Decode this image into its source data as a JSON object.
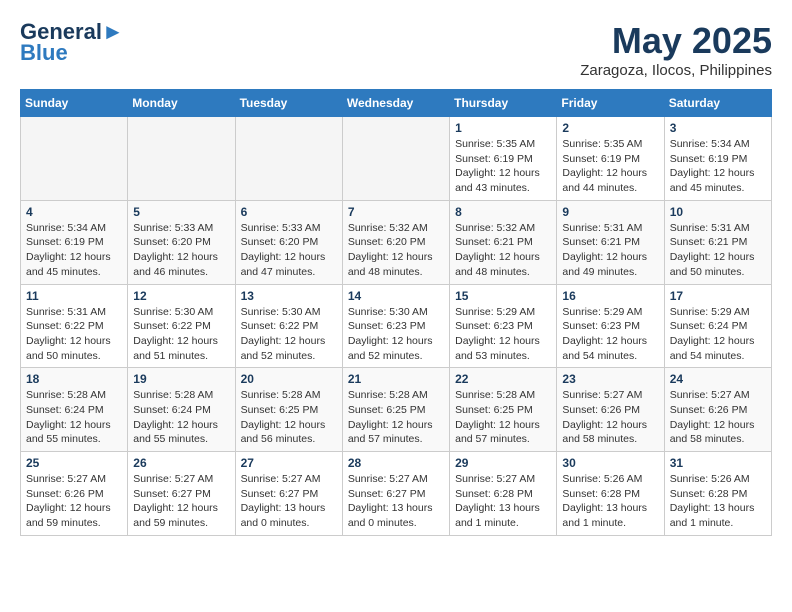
{
  "header": {
    "logo_line1": "General",
    "logo_line2": "Blue",
    "month": "May 2025",
    "location": "Zaragoza, Ilocos, Philippines"
  },
  "weekdays": [
    "Sunday",
    "Monday",
    "Tuesday",
    "Wednesday",
    "Thursday",
    "Friday",
    "Saturday"
  ],
  "weeks": [
    [
      {
        "day": "",
        "info": ""
      },
      {
        "day": "",
        "info": ""
      },
      {
        "day": "",
        "info": ""
      },
      {
        "day": "",
        "info": ""
      },
      {
        "day": "1",
        "info": "Sunrise: 5:35 AM\nSunset: 6:19 PM\nDaylight: 12 hours\nand 43 minutes."
      },
      {
        "day": "2",
        "info": "Sunrise: 5:35 AM\nSunset: 6:19 PM\nDaylight: 12 hours\nand 44 minutes."
      },
      {
        "day": "3",
        "info": "Sunrise: 5:34 AM\nSunset: 6:19 PM\nDaylight: 12 hours\nand 45 minutes."
      }
    ],
    [
      {
        "day": "4",
        "info": "Sunrise: 5:34 AM\nSunset: 6:19 PM\nDaylight: 12 hours\nand 45 minutes."
      },
      {
        "day": "5",
        "info": "Sunrise: 5:33 AM\nSunset: 6:20 PM\nDaylight: 12 hours\nand 46 minutes."
      },
      {
        "day": "6",
        "info": "Sunrise: 5:33 AM\nSunset: 6:20 PM\nDaylight: 12 hours\nand 47 minutes."
      },
      {
        "day": "7",
        "info": "Sunrise: 5:32 AM\nSunset: 6:20 PM\nDaylight: 12 hours\nand 48 minutes."
      },
      {
        "day": "8",
        "info": "Sunrise: 5:32 AM\nSunset: 6:21 PM\nDaylight: 12 hours\nand 48 minutes."
      },
      {
        "day": "9",
        "info": "Sunrise: 5:31 AM\nSunset: 6:21 PM\nDaylight: 12 hours\nand 49 minutes."
      },
      {
        "day": "10",
        "info": "Sunrise: 5:31 AM\nSunset: 6:21 PM\nDaylight: 12 hours\nand 50 minutes."
      }
    ],
    [
      {
        "day": "11",
        "info": "Sunrise: 5:31 AM\nSunset: 6:22 PM\nDaylight: 12 hours\nand 50 minutes."
      },
      {
        "day": "12",
        "info": "Sunrise: 5:30 AM\nSunset: 6:22 PM\nDaylight: 12 hours\nand 51 minutes."
      },
      {
        "day": "13",
        "info": "Sunrise: 5:30 AM\nSunset: 6:22 PM\nDaylight: 12 hours\nand 52 minutes."
      },
      {
        "day": "14",
        "info": "Sunrise: 5:30 AM\nSunset: 6:23 PM\nDaylight: 12 hours\nand 52 minutes."
      },
      {
        "day": "15",
        "info": "Sunrise: 5:29 AM\nSunset: 6:23 PM\nDaylight: 12 hours\nand 53 minutes."
      },
      {
        "day": "16",
        "info": "Sunrise: 5:29 AM\nSunset: 6:23 PM\nDaylight: 12 hours\nand 54 minutes."
      },
      {
        "day": "17",
        "info": "Sunrise: 5:29 AM\nSunset: 6:24 PM\nDaylight: 12 hours\nand 54 minutes."
      }
    ],
    [
      {
        "day": "18",
        "info": "Sunrise: 5:28 AM\nSunset: 6:24 PM\nDaylight: 12 hours\nand 55 minutes."
      },
      {
        "day": "19",
        "info": "Sunrise: 5:28 AM\nSunset: 6:24 PM\nDaylight: 12 hours\nand 55 minutes."
      },
      {
        "day": "20",
        "info": "Sunrise: 5:28 AM\nSunset: 6:25 PM\nDaylight: 12 hours\nand 56 minutes."
      },
      {
        "day": "21",
        "info": "Sunrise: 5:28 AM\nSunset: 6:25 PM\nDaylight: 12 hours\nand 57 minutes."
      },
      {
        "day": "22",
        "info": "Sunrise: 5:28 AM\nSunset: 6:25 PM\nDaylight: 12 hours\nand 57 minutes."
      },
      {
        "day": "23",
        "info": "Sunrise: 5:27 AM\nSunset: 6:26 PM\nDaylight: 12 hours\nand 58 minutes."
      },
      {
        "day": "24",
        "info": "Sunrise: 5:27 AM\nSunset: 6:26 PM\nDaylight: 12 hours\nand 58 minutes."
      }
    ],
    [
      {
        "day": "25",
        "info": "Sunrise: 5:27 AM\nSunset: 6:26 PM\nDaylight: 12 hours\nand 59 minutes."
      },
      {
        "day": "26",
        "info": "Sunrise: 5:27 AM\nSunset: 6:27 PM\nDaylight: 12 hours\nand 59 minutes."
      },
      {
        "day": "27",
        "info": "Sunrise: 5:27 AM\nSunset: 6:27 PM\nDaylight: 13 hours\nand 0 minutes."
      },
      {
        "day": "28",
        "info": "Sunrise: 5:27 AM\nSunset: 6:27 PM\nDaylight: 13 hours\nand 0 minutes."
      },
      {
        "day": "29",
        "info": "Sunrise: 5:27 AM\nSunset: 6:28 PM\nDaylight: 13 hours\nand 1 minute."
      },
      {
        "day": "30",
        "info": "Sunrise: 5:26 AM\nSunset: 6:28 PM\nDaylight: 13 hours\nand 1 minute."
      },
      {
        "day": "31",
        "info": "Sunrise: 5:26 AM\nSunset: 6:28 PM\nDaylight: 13 hours\nand 1 minute."
      }
    ]
  ]
}
